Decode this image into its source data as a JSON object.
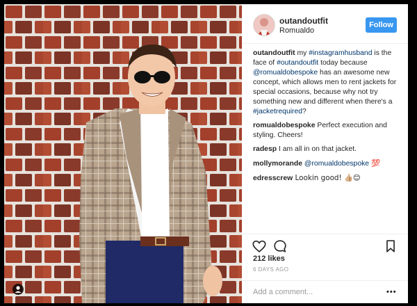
{
  "post": {
    "username": "outandoutfit",
    "location": "Romualdo",
    "follow_label": "Follow",
    "caption": {
      "user": "outandoutfit",
      "parts": [
        {
          "text": " my ",
          "link": false
        },
        {
          "text": "#instagramhusband",
          "link": true
        },
        {
          "text": " is the face of ",
          "link": false
        },
        {
          "text": "#outandoutfit",
          "link": true
        },
        {
          "text": " today because ",
          "link": false
        },
        {
          "text": "@romualdobespoke",
          "link": true
        },
        {
          "text": " has an awesome new concept, which allows men to rent jackets for special occasions, because why not try something new and different when there's a ",
          "link": false
        },
        {
          "text": "#jacketrequired",
          "link": true
        },
        {
          "text": "?",
          "link": false
        }
      ]
    },
    "comments": [
      {
        "user": "romualdobespoke",
        "parts": [
          {
            "text": " Perfect execution and styling. Cheers!",
            "link": false
          }
        ]
      },
      {
        "user": "radesp",
        "parts": [
          {
            "text": " I am all in on that jacket.",
            "link": false
          }
        ]
      },
      {
        "user": "mollymorande",
        "parts": [
          {
            "text": " ",
            "link": false
          },
          {
            "text": "@romualdobespoke",
            "link": true
          },
          {
            "text": " 💯",
            "link": false
          }
        ]
      },
      {
        "user": "edresscrew",
        "parts": [
          {
            "text": " Lookin good! 👍🏼😊",
            "link": false
          }
        ]
      }
    ],
    "likes_label": "212 likes",
    "posted_label": "6 DAYS AGO",
    "comment_placeholder": "Add a comment...",
    "more_label": "•••"
  },
  "icons": {
    "like": "heart-icon",
    "comment": "comment-bubble-icon",
    "save": "bookmark-icon",
    "more": "more-options-icon",
    "user_tag": "user-tag-icon"
  },
  "colors": {
    "follow_button": "#3897f0",
    "link": "#003569",
    "meta_gray": "#999999",
    "divider": "#efefef"
  }
}
